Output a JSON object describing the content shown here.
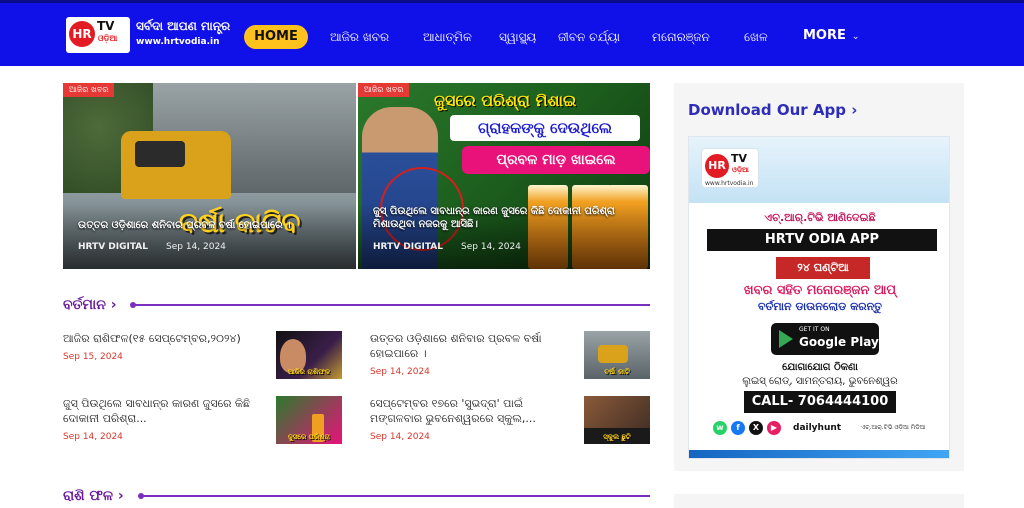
{
  "header": {
    "logo_hr": "HR",
    "logo_tv": "TV",
    "logo_odia": "ଓଡ଼ିଆ",
    "tagline": "ସର୍ବଦା ଆପଣ ମାନ୍ତ୍ର",
    "site_url": "www.hrtvodia.in",
    "colors": {
      "background": "#1010e8",
      "home_pill": "#ffc21c"
    }
  },
  "nav": {
    "home": "HOME",
    "items": [
      "ଆଜିର ଖବର",
      "ଆଧାତ୍ମିକ",
      "ସ୍ୱାସ୍ଥ୍ୟ",
      "ଜୀବନ ଚର୍ଯ୍ୟା",
      "ମନୋରଞ୍ଜନ",
      "ଖେଳ"
    ],
    "more": "MORE"
  },
  "hero": [
    {
      "tag": "ଆଜିର ଖବର",
      "title": "ଉତ୍ତର ଓଡ଼ିଶାରେ ଶନିବାର ପ୍ରବଳ ବର୍ଷା ହୋଇପାରେ ।",
      "overlay_text": "ବର୍ଷା କାଟିବ",
      "author": "HRTV DIGITAL",
      "date": "Sep 14, 2024"
    },
    {
      "tag": "ଆଜିର ଖବର",
      "banner1": "ଜୁସରେ ପରିଶ୍ରା ମିଶାଇ",
      "banner2": "ଗ୍ରାହକଙ୍କୁ ଦେଉଥିଲେ",
      "banner3": "ପ୍ରବଳ ମାଡ଼ ଖାଇଲେ",
      "title": "ଜୁସ୍ ପିଉଥିଲେ ସାବଧାନ୍ର କାରଣ ଜୁସରେ କିଛି ଦୋକାନୀ ପରିଶ୍ରା ମିଶାଉଥିବା ନଜରକୁ ଆସିଛି।",
      "author": "HRTV DIGITAL",
      "date": "Sep 14, 2024"
    }
  ],
  "section_current": {
    "title": "ବର୍ତମାନ",
    "items": [
      {
        "title": "ଆଜିର ରାଶିଫଳ(୧୫ ସେପ୍ଟେମ୍ବର,୨୦୨୪)",
        "date": "Sep 15, 2024",
        "thumb_caption": "ଆଜିର ରାଶିଫଳ"
      },
      {
        "title": "ଉତ୍ତର ଓଡ଼ିଶାରେ ଶନିବାର ପ୍ରବଳ ବର୍ଷା ହୋଇପାରେ ।",
        "date": "Sep 14, 2024",
        "thumb_caption": "ବର୍ଷା କାଟି"
      },
      {
        "title": "ଜୁସ୍ ପିଉଥିଲେ ସାବଧାନ୍ର କାରଣ ଜୁସରେ କିଛି ଦୋକାନୀ ପରିଶ୍ରା...",
        "date": "Sep 14, 2024",
        "thumb_caption": "ଜୁସରେ ପରିଶ୍ରା"
      },
      {
        "title": "ସେପ୍ଟେମ୍ବର ୧୭ରେ 'ସୁଭଦ୍ରା' ପାଇଁ ମଙ୍ଗଳବାର ଭୁବନେଶ୍ୱରରେ ସ୍କୁଲ,...",
        "date": "Sep 14, 2024",
        "thumb_caption": "ସ୍କୁଲ ଛୁଟି"
      }
    ]
  },
  "section_rashifal": {
    "title": "ରାଶି ଫଳ"
  },
  "sidebar": {
    "app_title": "Download Our App",
    "ad": {
      "logo_hr": "HR",
      "logo_tv": "TV",
      "logo_odia": "ଓଡ଼ିଆ",
      "logo_url": "www.hrtvodia.in",
      "line1": "ଏଚ୍.ଆର୍.ଟିଭି ଆଣିଦେଇଛି",
      "app_name": "HRTV ODIA APP",
      "hours": "୨୪ ଘଣ୍ଟିଆ",
      "line2": "ଖବର ସହିତ ମନୋରଞ୍ଜନ ଆପ୍",
      "line3": "ବର୍ତମାନ ଡାଉନଲୋଡ କରନ୍ତୁ",
      "play_small": "GET IT ON",
      "play_big": "Google Play",
      "contact1": "ଯୋଗାଯୋଗ ଠିକଣା",
      "contact2": "ଲୁଇସ୍ ରୋଡ୍, ସାମନ୍ତରାୟ, ଭୁବନେଶ୍ୱର",
      "call": "CALL- 7064444100",
      "dailyhunt": "dailyhunt",
      "footer": "ଏଚ୍.ଆର୍.ଟିଭି ଓଡ଼ିଆ ମିଡିଆ"
    }
  }
}
